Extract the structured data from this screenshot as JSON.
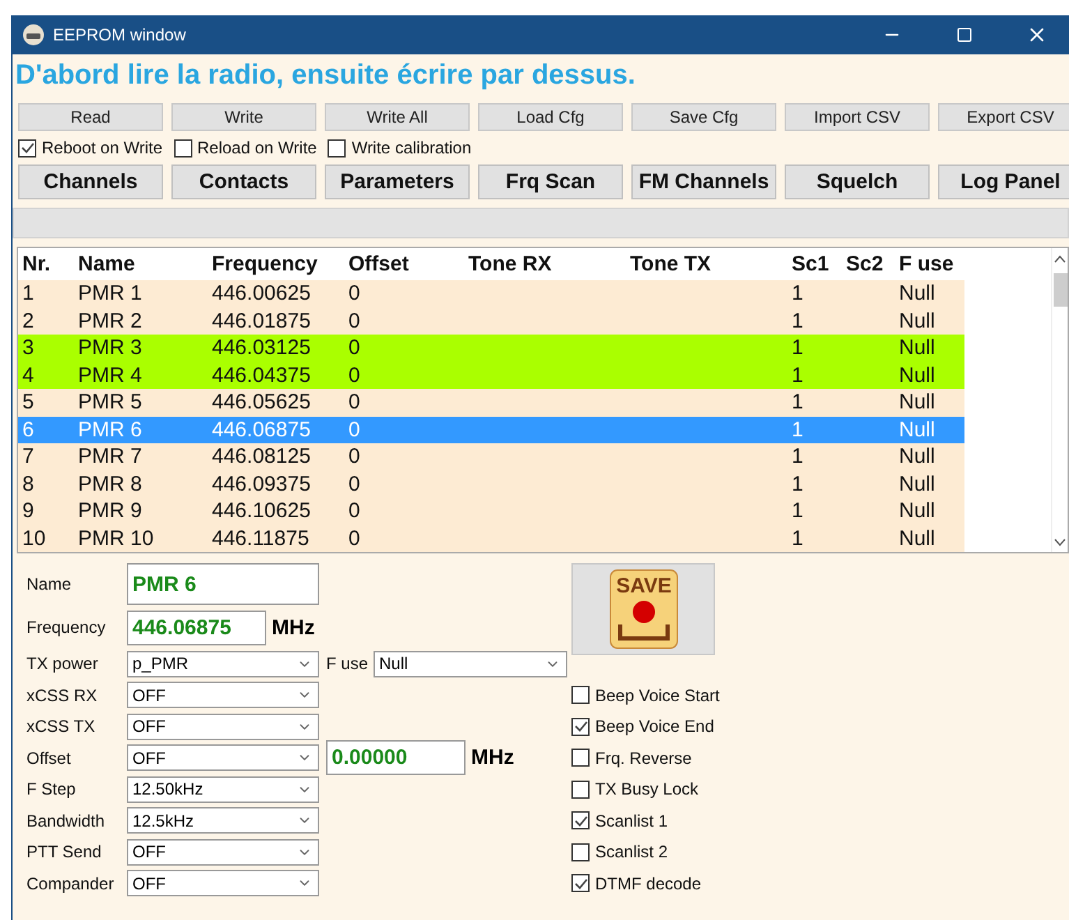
{
  "window": {
    "title": "EEPROM window"
  },
  "notice": "D'abord lire la radio, ensuite écrire par dessus.",
  "actions": [
    "Read",
    "Write",
    "Write All",
    "Load Cfg",
    "Save Cfg",
    "Import CSV",
    "Export CSV"
  ],
  "write_options": [
    {
      "label": "Reboot on Write",
      "checked": true
    },
    {
      "label": "Reload on Write",
      "checked": false
    },
    {
      "label": "Write calibration",
      "checked": false
    }
  ],
  "tabs": [
    "Channels",
    "Contacts",
    "Parameters",
    "Frq Scan",
    "FM Channels",
    "Squelch",
    "Log Panel"
  ],
  "table": {
    "columns": [
      "Nr.",
      "Name",
      "Frequency",
      "Offset",
      "Tone RX",
      "Tone TX",
      "Sc1",
      "Sc2",
      "F use"
    ],
    "rows": [
      {
        "cells": [
          "1",
          "PMR 1",
          "446.00625",
          "0",
          "",
          "",
          "1",
          "",
          "Null"
        ],
        "selected": false,
        "color": "#fdebd3"
      },
      {
        "cells": [
          "2",
          "PMR 2",
          "446.01875",
          "0",
          "",
          "",
          "1",
          "",
          "Null"
        ],
        "selected": false,
        "color": "#fdebd3"
      },
      {
        "cells": [
          "3",
          "PMR 3",
          "446.03125",
          "0",
          "",
          "",
          "1",
          "",
          "Null"
        ],
        "selected": false,
        "color": "#aaff00"
      },
      {
        "cells": [
          "4",
          "PMR 4",
          "446.04375",
          "0",
          "",
          "",
          "1",
          "",
          "Null"
        ],
        "selected": false,
        "color": "#aaff00"
      },
      {
        "cells": [
          "5",
          "PMR 5",
          "446.05625",
          "0",
          "",
          "",
          "1",
          "",
          "Null"
        ],
        "selected": false,
        "color": "#fdebd3"
      },
      {
        "cells": [
          "6",
          "PMR 6",
          "446.06875",
          "0",
          "",
          "",
          "1",
          "",
          "Null"
        ],
        "selected": true
      },
      {
        "cells": [
          "7",
          "PMR 7",
          "446.08125",
          "0",
          "",
          "",
          "1",
          "",
          "Null"
        ],
        "selected": false,
        "color": "#fdebd3"
      },
      {
        "cells": [
          "8",
          "PMR 8",
          "446.09375",
          "0",
          "",
          "",
          "1",
          "",
          "Null"
        ],
        "selected": false,
        "color": "#fdebd3"
      },
      {
        "cells": [
          "9",
          "PMR 9",
          "446.10625",
          "0",
          "",
          "",
          "1",
          "",
          "Null"
        ],
        "selected": false,
        "color": "#fdebd3"
      },
      {
        "cells": [
          "10",
          "PMR 10",
          "446.11875",
          "0",
          "",
          "",
          "1",
          "",
          "Null"
        ],
        "selected": false,
        "color": "#fdebd3"
      }
    ]
  },
  "editor": {
    "name": {
      "label": "Name",
      "value": "PMR 6"
    },
    "frequency": {
      "label": "Frequency",
      "value": "446.06875",
      "unit": "MHz"
    },
    "save_button": {
      "label": "SAVE"
    },
    "settings": [
      {
        "label": "TX power",
        "value": "p_PMR",
        "side": {
          "kind": "select",
          "label": "F use",
          "value": "Null"
        }
      },
      {
        "label": "xCSS RX",
        "value": "OFF"
      },
      {
        "label": "xCSS TX",
        "value": "OFF"
      },
      {
        "label": "Offset",
        "value": "OFF",
        "side": {
          "kind": "input",
          "value": "0.00000",
          "unit": "MHz"
        }
      },
      {
        "label": "F Step",
        "value": "12.50kHz"
      },
      {
        "label": "Bandwidth",
        "value": "12.5kHz"
      },
      {
        "label": "PTT Send",
        "value": "OFF"
      },
      {
        "label": "Compander",
        "value": "OFF"
      }
    ],
    "flags": [
      {
        "label": "Beep Voice Start",
        "checked": false
      },
      {
        "label": "Beep Voice End",
        "checked": true
      },
      {
        "label": "Frq. Reverse",
        "checked": false
      },
      {
        "label": "TX Busy Lock",
        "checked": false
      },
      {
        "label": "Scanlist 1",
        "checked": true
      },
      {
        "label": "Scanlist 2",
        "checked": false
      },
      {
        "label": "DTMF decode",
        "checked": true
      }
    ]
  }
}
